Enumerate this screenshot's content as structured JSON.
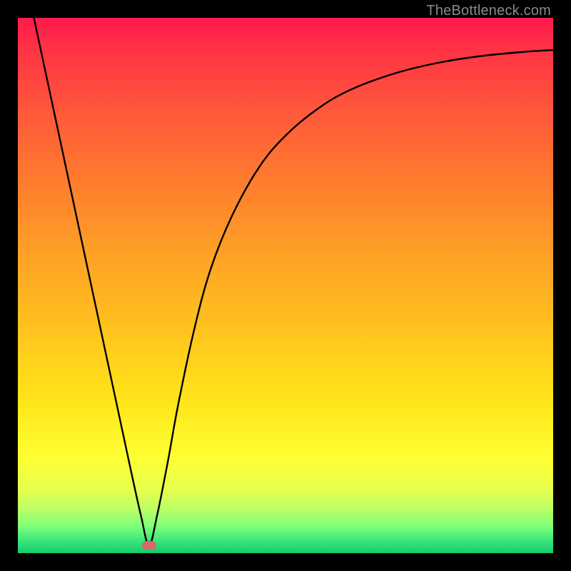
{
  "watermark": "TheBottleneck.com",
  "colors": {
    "curve_stroke": "#000000",
    "marker_fill": "#d46a6a"
  },
  "chart_data": {
    "type": "line",
    "title": "",
    "xlabel": "",
    "ylabel": "",
    "xlim": [
      0,
      100
    ],
    "ylim": [
      0,
      100
    ],
    "grid": false,
    "legend": false,
    "annotations": [
      {
        "name": "marker",
        "x": 24.5,
        "y": 1.5
      }
    ],
    "series": [
      {
        "name": "bottleneck-curve",
        "x": [
          3,
          6,
          9,
          12,
          15,
          18,
          21,
          23,
          24.5,
          26,
          28,
          30,
          33,
          36,
          40,
          45,
          50,
          56,
          62,
          70,
          78,
          86,
          94,
          100
        ],
        "y": [
          100,
          86,
          72,
          58,
          44,
          30,
          16,
          7,
          1.5,
          7,
          17,
          28,
          42,
          53,
          63,
          72,
          78,
          83,
          86.5,
          89.5,
          91.5,
          92.8,
          93.6,
          94
        ]
      }
    ]
  }
}
